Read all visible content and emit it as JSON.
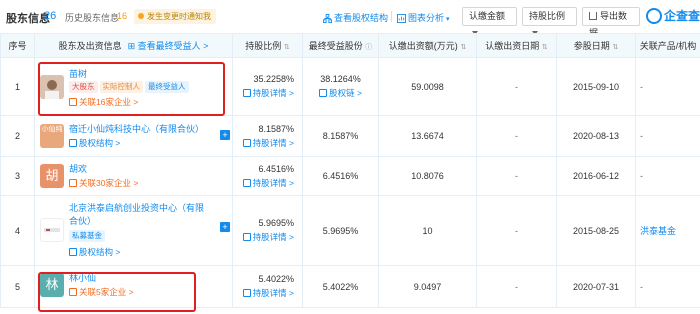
{
  "toolbar": {
    "title": "股东信息",
    "count": "26",
    "history_label": "历史股东信息",
    "history_count": "16",
    "change_badge": "发生变更时通知我",
    "link_structure": "查看股权结构",
    "link_chart": "图表分析",
    "btn_amount": "认缴金额",
    "btn_ratio": "持股比例",
    "btn_export": "导出数据",
    "logo": "企查查"
  },
  "table": {
    "headers": {
      "no": "序号",
      "shareholder": "股东及出资信息",
      "beneficiary_link": "查看最终受益人 >",
      "ratio": "持股比例",
      "final_ratio": "最终受益股份",
      "subscribed_amount": "认缴出资额(万元)",
      "subscribed_date": "认缴出资日期",
      "join_date": "参股日期",
      "related": "关联产品/机构"
    },
    "rows": [
      {
        "no": "1",
        "name": "苗树",
        "tags": [
          "大股东",
          "实际控制人",
          "最终受益人"
        ],
        "rel": "关联16家企业 >",
        "ratio": "35.2258%",
        "ratio_link": "持股详情 >",
        "final_ratio": "38.1264%",
        "final_link": "股权链 >",
        "amount": "59.0098",
        "sub_date": "-",
        "join_date": "2015-09-10",
        "related": "-"
      },
      {
        "no": "2",
        "avatar_text": "小仙纯",
        "name": "宿迁小仙炖科技中心（有限合伙）",
        "rel": "股权结构 >",
        "ratio": "8.1587%",
        "ratio_link": "持股详情 >",
        "final_ratio": "8.1587%",
        "amount": "13.6674",
        "sub_date": "-",
        "join_date": "2020-08-13",
        "related": "-"
      },
      {
        "no": "3",
        "avatar_text": "胡",
        "name": "胡欢",
        "rel": "关联30家企业 >",
        "ratio": "6.4516%",
        "ratio_link": "持股详情 >",
        "final_ratio": "6.4516%",
        "amount": "10.8076",
        "sub_date": "-",
        "join_date": "2016-06-12",
        "related": "-"
      },
      {
        "no": "4",
        "name": "北京洪泰启航创业投资中心（有限合伙）",
        "tag": "私募基金",
        "rel": "股权结构 >",
        "ratio": "5.9695%",
        "ratio_link": "持股详情 >",
        "final_ratio": "5.9695%",
        "amount": "10",
        "sub_date": "-",
        "join_date": "2015-08-25",
        "related": "洪泰基金"
      },
      {
        "no": "5",
        "avatar_text": "林",
        "name": "林小仙",
        "rel": "关联5家企业 >",
        "ratio": "5.4022%",
        "ratio_link": "持股详情 >",
        "final_ratio": "5.4022%",
        "amount": "9.0497",
        "sub_date": "-",
        "join_date": "2020-07-31",
        "related": "-"
      }
    ]
  },
  "colors": {
    "accent": "#128bed",
    "highlight": "#e02020",
    "header_bg": "#f2f9fc",
    "orange": "#f56c1e"
  }
}
